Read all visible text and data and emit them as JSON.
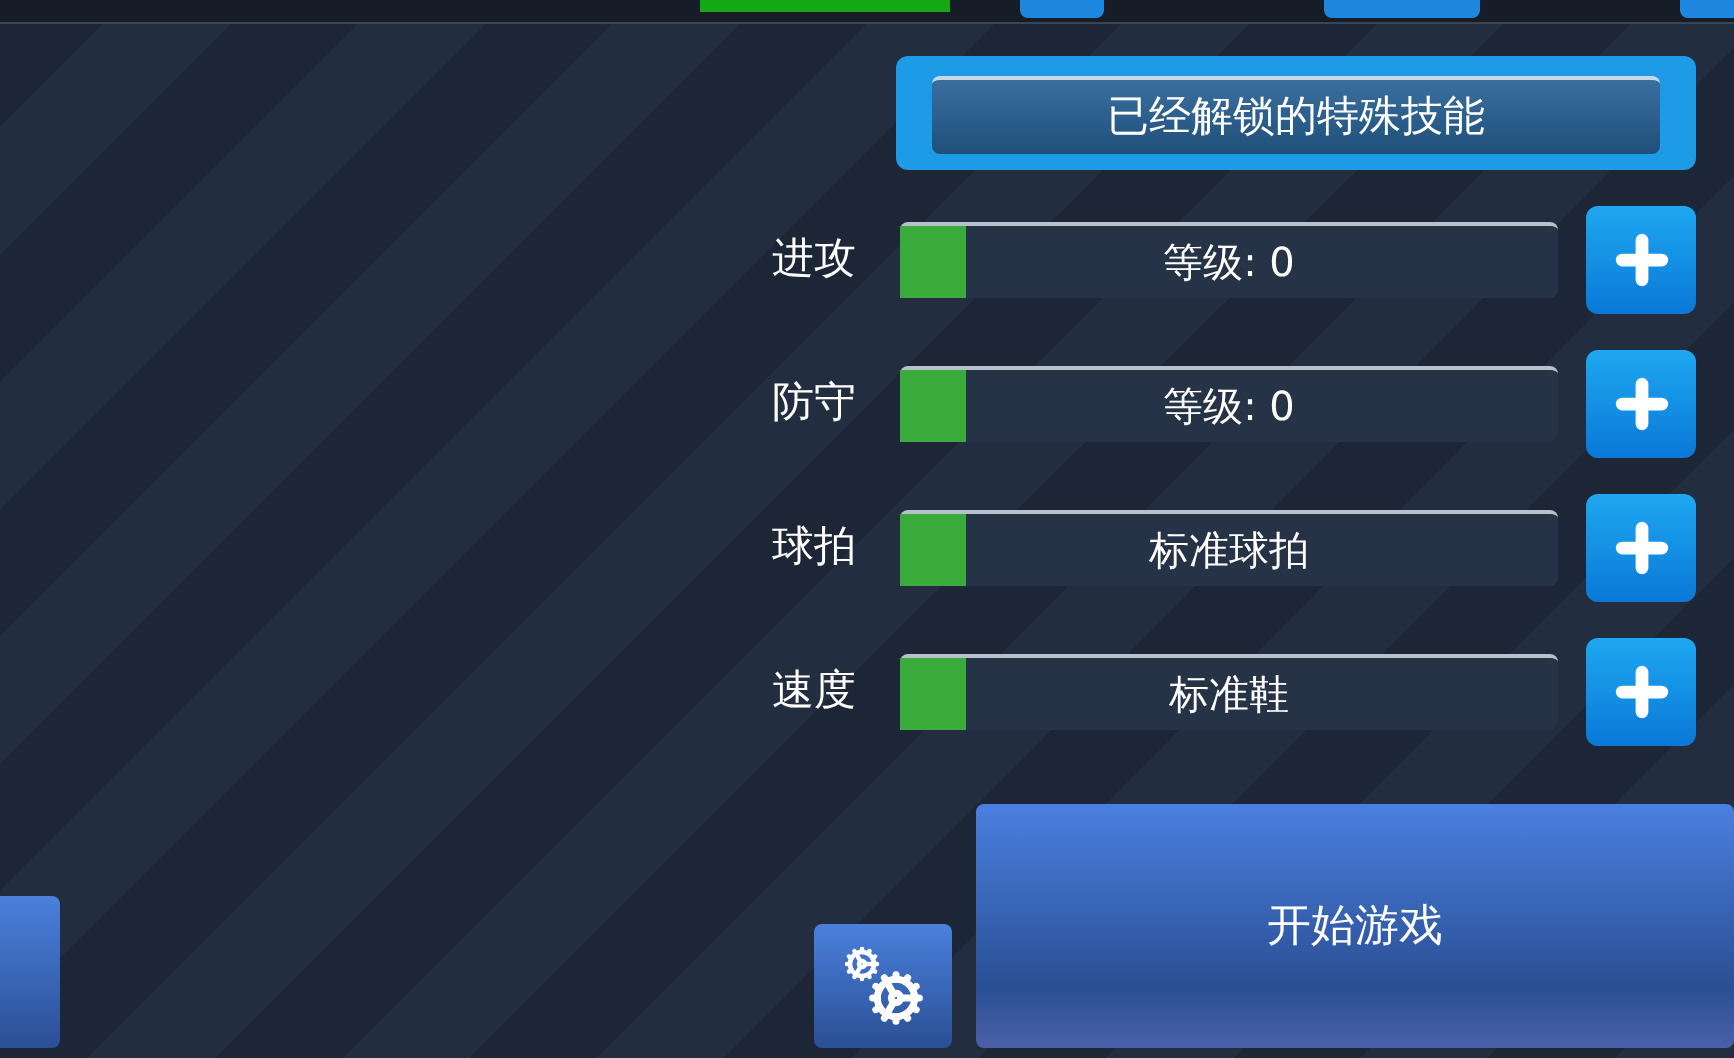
{
  "special_skills_button": "已经解锁的特殊技能",
  "stats": [
    {
      "label": "进攻",
      "value": "等级: 0",
      "level": 0.1
    },
    {
      "label": "防守",
      "value": "等级: 0",
      "level": 0.1
    },
    {
      "label": "球拍",
      "value": "标准球拍",
      "level": 0.1
    },
    {
      "label": "速度",
      "value": "标准鞋",
      "level": 0.1
    }
  ],
  "start_button": "开始游戏"
}
